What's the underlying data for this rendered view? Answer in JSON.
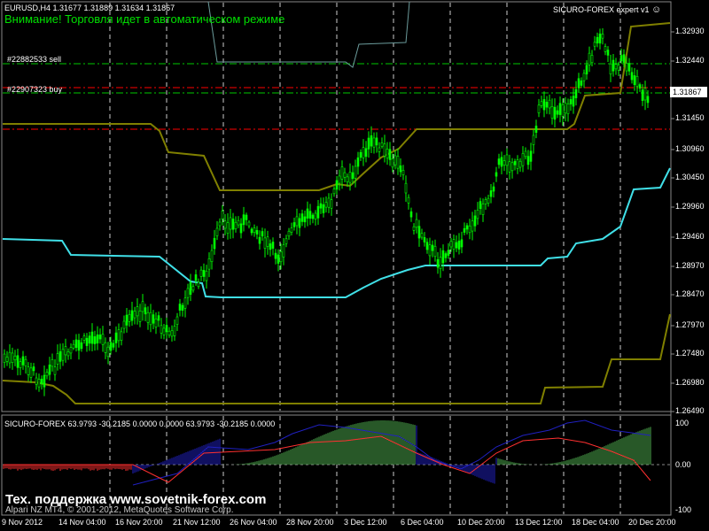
{
  "symbol_info": "EURUSD,H4  1.31677 1.31889 1.31634 1.31867",
  "warning": "Внимание! Торговля идет в автоматическом режиме",
  "expert": {
    "name": "SICURO-FOREX expert v1",
    "smile": "☺"
  },
  "orders": [
    {
      "label": "#22882533 sell",
      "color": "#00c800"
    },
    {
      "label": "#22907323 buy",
      "color": "#00c800"
    }
  ],
  "price_axis": [
    "1.32930",
    "1.32440",
    "1.31867",
    "1.31450",
    "1.30960",
    "1.30450",
    "1.29960",
    "1.29460",
    "1.28970",
    "1.28470",
    "1.27970",
    "1.27480",
    "1.26980",
    "1.26490"
  ],
  "current_price": "1.31867",
  "indicator": {
    "title": "SICURO-FOREX 63.9793 -30.2185 0.0000 0.0000 63.9793 -30.2185 0.0000",
    "axis": [
      "100",
      "0.00",
      "-100"
    ]
  },
  "time_axis": [
    "9 Nov 2012",
    "14 Nov 04:00",
    "16 Nov 20:00",
    "21 Nov 12:00",
    "26 Nov 04:00",
    "28 Nov 20:00",
    "3 Dec 12:00",
    "6 Dec 04:00",
    "10 Dec 20:00",
    "13 Dec 12:00",
    "18 Dec 04:00",
    "20 Dec 20:00"
  ],
  "support_text": "Тех. поддержка www.sovetnik-forex.com",
  "copyright": "Alpari NZ MT4, © 2001-2012, MetaQuotes Software Corp.",
  "colors": {
    "bull": "#00ff00",
    "olive": "#808000",
    "cyan": "#40e0e8",
    "sell": "#00c800",
    "buy": "#ff0000",
    "hist_up": "#2020c0",
    "hist_green": "#50b050",
    "hist_red": "#ff3030"
  }
}
